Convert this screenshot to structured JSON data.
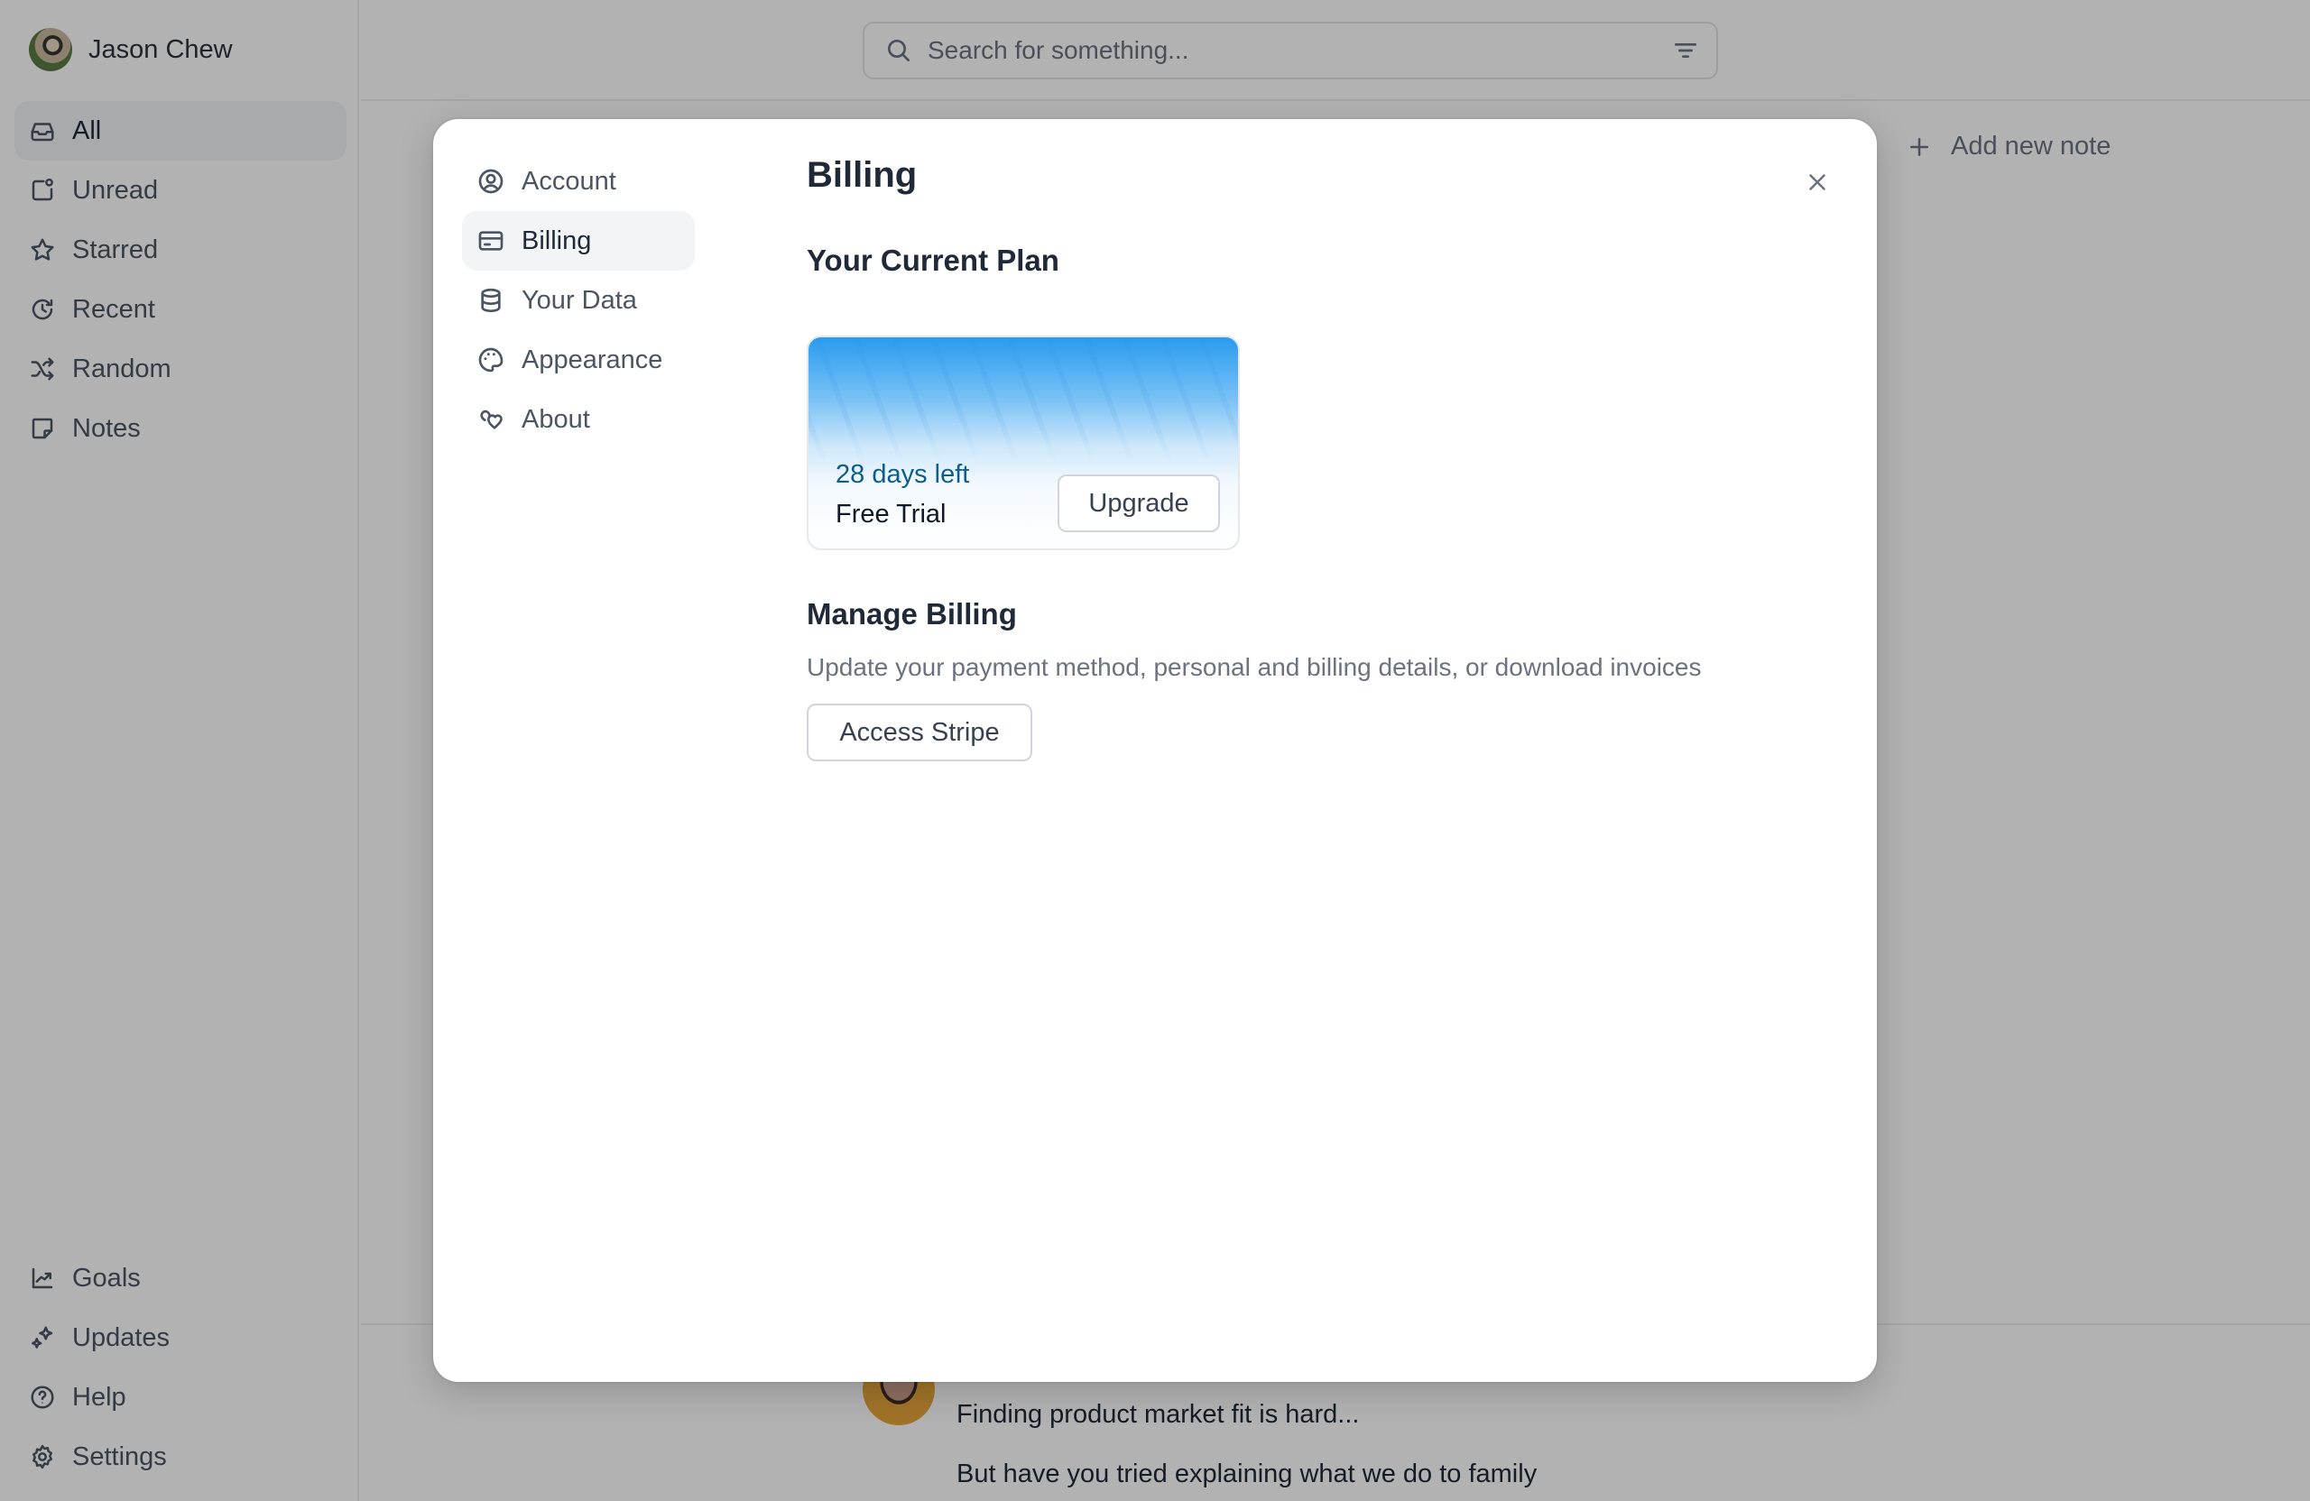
{
  "user": {
    "name": "Jason Chew"
  },
  "sidebar": {
    "top_items": [
      {
        "label": "All",
        "icon": "inbox-icon",
        "active": true
      },
      {
        "label": "Unread",
        "icon": "unread-icon"
      },
      {
        "label": "Starred",
        "icon": "star-icon"
      },
      {
        "label": "Recent",
        "icon": "history-icon"
      },
      {
        "label": "Random",
        "icon": "shuffle-icon"
      },
      {
        "label": "Notes",
        "icon": "sticky-note-icon"
      }
    ],
    "bottom_items": [
      {
        "label": "Goals",
        "icon": "chart-line-icon"
      },
      {
        "label": "Updates",
        "icon": "sparkles-icon"
      },
      {
        "label": "Help",
        "icon": "help-circle-icon"
      },
      {
        "label": "Settings",
        "icon": "gear-icon"
      }
    ]
  },
  "search": {
    "placeholder": "Search for something..."
  },
  "main": {
    "add_note_label": "Add new note",
    "note": {
      "lines": [
        "Finding product market fit is hard...",
        "But have you tried explaining what we do to family"
      ]
    }
  },
  "modal": {
    "nav": [
      {
        "label": "Account",
        "icon": "user-circle-icon"
      },
      {
        "label": "Billing",
        "icon": "credit-card-icon",
        "active": true
      },
      {
        "label": "Your Data",
        "icon": "database-icon"
      },
      {
        "label": "Appearance",
        "icon": "palette-icon"
      },
      {
        "label": "About",
        "icon": "hearts-icon"
      }
    ],
    "title": "Billing",
    "current_plan": {
      "heading": "Your Current Plan",
      "days_left": "28 days left",
      "plan_name": "Free Trial",
      "upgrade_label": "Upgrade",
      "accent_color": "#2a9bf0"
    },
    "manage_billing": {
      "heading": "Manage Billing",
      "description": "Update your payment method, personal and billing details, or download invoices",
      "button_label": "Access Stripe"
    }
  }
}
